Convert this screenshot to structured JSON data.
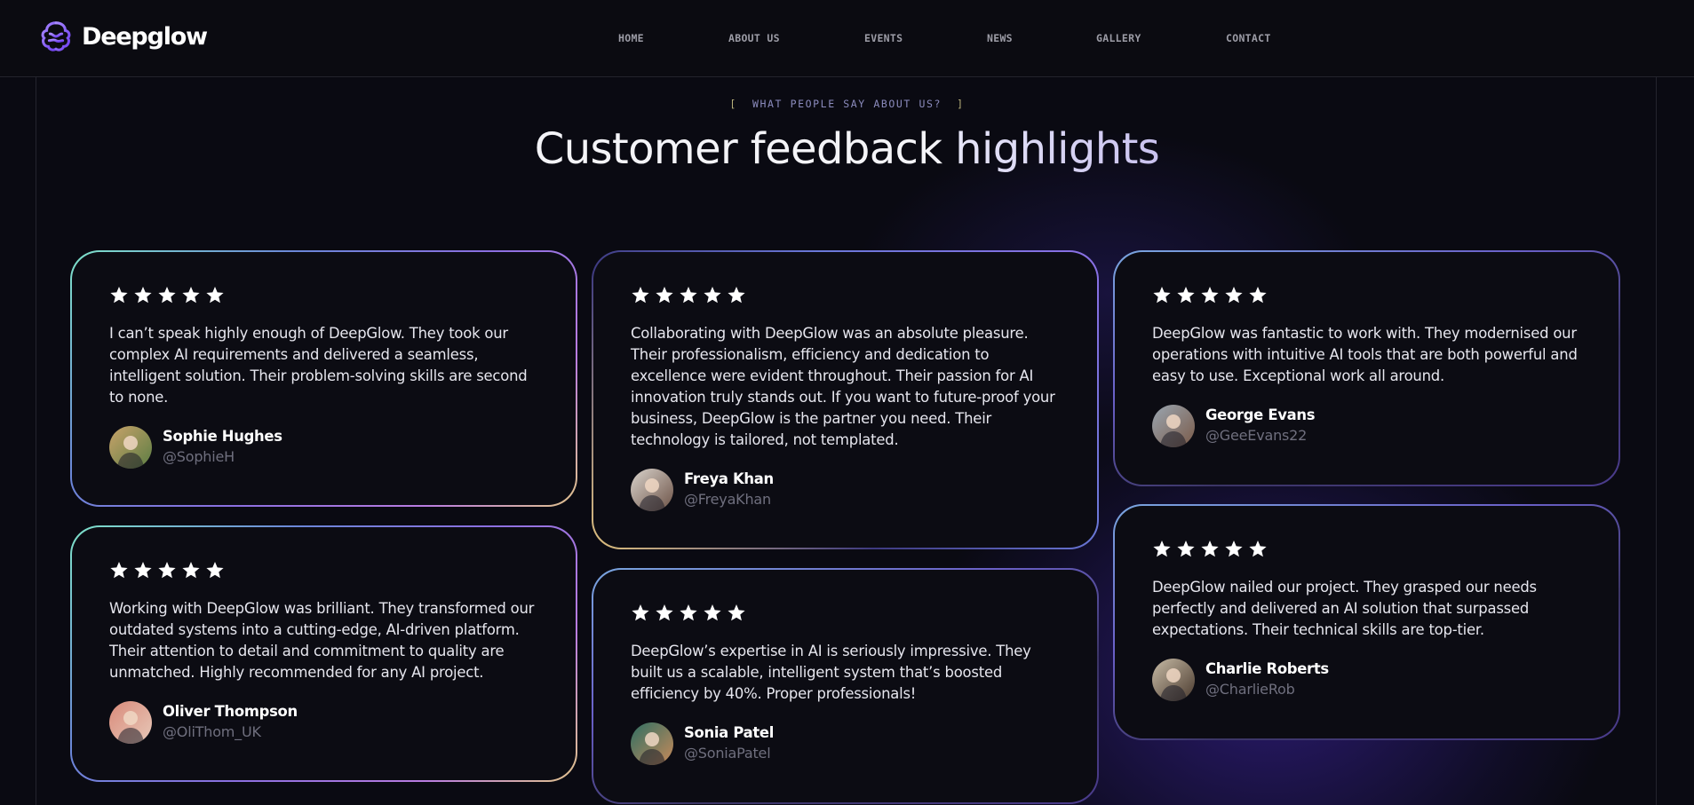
{
  "brand": {
    "name": "Deepglow",
    "accent": "#8b5cf6"
  },
  "nav": {
    "items": [
      "HOME",
      "ABOUT US",
      "EVENTS",
      "NEWS",
      "GALLERY",
      "CONTACT"
    ]
  },
  "section": {
    "eyebrow_open": "[",
    "eyebrow": "WHAT PEOPLE SAY ABOUT US?",
    "eyebrow_close": "]",
    "title_main": "Customer feedback",
    "title_highlight": "highlights"
  },
  "testimonials": [
    {
      "rating": 5,
      "quote": "I can’t speak highly enough of DeepGlow. They took our complex AI requirements and delivered a seamless, intelligent solution. Their problem-solving skills are second to none.",
      "name": "Sophie Hughes",
      "handle": "@SophieH",
      "avatar_colors": [
        "#c9a36a",
        "#5b7d43"
      ]
    },
    {
      "rating": 5,
      "quote": "Collaborating with DeepGlow was an absolute pleasure. Their professionalism, efficiency and dedication to excellence were evident throughout. Their passion for AI innovation truly stands out. If you want to future-proof your business, DeepGlow is the partner you need. Their technology is tailored, not templated.",
      "name": "Freya Khan",
      "handle": "@FreyaKhan",
      "avatar_colors": [
        "#d9d3cc",
        "#6c5246"
      ]
    },
    {
      "rating": 5,
      "quote": "DeepGlow was fantastic to work with. They modernised our operations with intuitive AI tools that are both powerful and easy to use. Exceptional work all around.",
      "name": "George Evans",
      "handle": "@GeeEvans22",
      "avatar_colors": [
        "#9aa6b1",
        "#7a5a48"
      ]
    },
    {
      "rating": 5,
      "quote": "Working with DeepGlow was brilliant. They transformed our outdated systems into a cutting-edge, AI-driven platform. Their attention to detail and commitment to quality are unmatched. Highly recommended for any AI project.",
      "name": "Oliver Thompson",
      "handle": "@OliThom_UK",
      "avatar_colors": [
        "#d98a7a",
        "#e7c9b9"
      ]
    },
    {
      "rating": 5,
      "quote": "DeepGlow’s expertise in AI is seriously impressive. They built us a scalable, intelligent system that’s boosted efficiency by 40%. Proper professionals!",
      "name": "Sonia Patel",
      "handle": "@SoniaPatel",
      "avatar_colors": [
        "#2f6f63",
        "#c88a5a"
      ]
    },
    {
      "rating": 5,
      "quote": "DeepGlow nailed our project. They grasped our needs perfectly and delivered an AI solution that surpassed expectations. Their technical skills are top-tier.",
      "name": "Charlie Roberts",
      "handle": "@CharlieRob",
      "avatar_colors": [
        "#c7bba6",
        "#4a3a2e"
      ]
    }
  ]
}
